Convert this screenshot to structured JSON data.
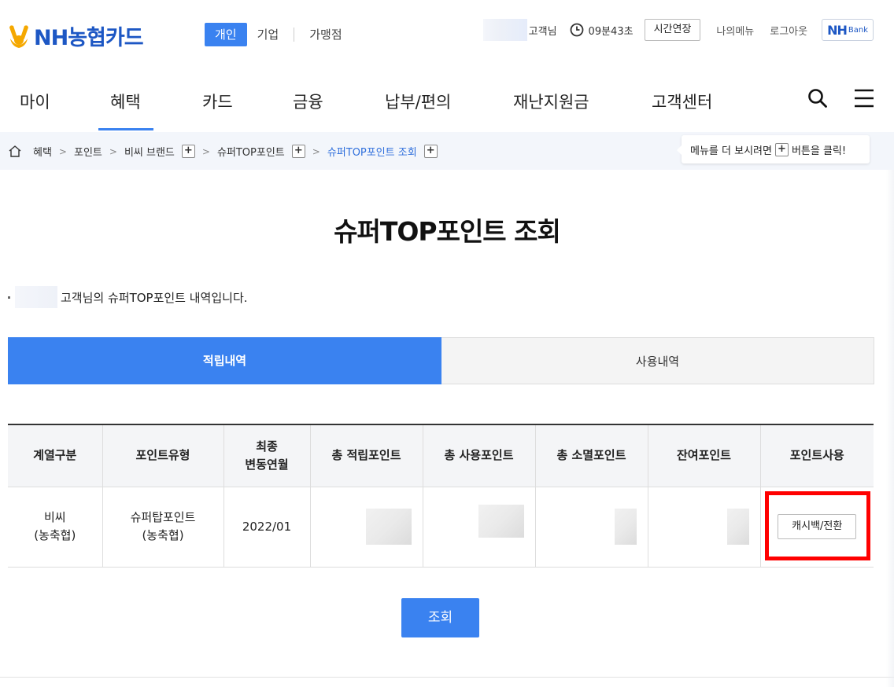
{
  "header": {
    "logo_text": "NH농협카드",
    "segments": [
      "개인",
      "기업",
      "가맹점"
    ],
    "user_suffix": "고객님",
    "session_time": "09분43초",
    "extend_label": "시간연장",
    "my_menu": "나의메뉴",
    "logout": "로그아웃",
    "nhbank_nh": "NH",
    "nhbank_bank": "Bank",
    "brand_color": "#1d57c4",
    "accent_color": "#3a82f0"
  },
  "nav": {
    "items": [
      "마이",
      "혜택",
      "카드",
      "금융",
      "납부/편의",
      "재난지원금",
      "고객센터"
    ],
    "active": "혜택"
  },
  "breadcrumb": {
    "items": [
      "혜택",
      "포인트",
      "비씨 브랜드",
      "슈퍼TOP포인트",
      "슈퍼TOP포인트 조회"
    ],
    "tooltip_before": "메뉴를 더 보시려면",
    "tooltip_after": "버튼을 클릭!"
  },
  "page": {
    "title": "슈퍼TOP포인트 조회",
    "intro_suffix": "고객님의 슈퍼TOP포인트 내역입니다."
  },
  "tabs": [
    "적립내역",
    "사용내역"
  ],
  "table": {
    "headers": [
      "계열구분",
      "포인트유형",
      "최종\n변동연월",
      "총 적립포인트",
      "총 사용포인트",
      "총 소멸포인트",
      "잔여포인트",
      "포인트사용"
    ],
    "row": {
      "group": "비씨\n(농축협)",
      "type": "슈퍼탑포인트\n(농축협)",
      "month": "2022/01",
      "action": "캐시백/전환"
    }
  },
  "search_button": "조회",
  "highlight_color": "#ff0000"
}
